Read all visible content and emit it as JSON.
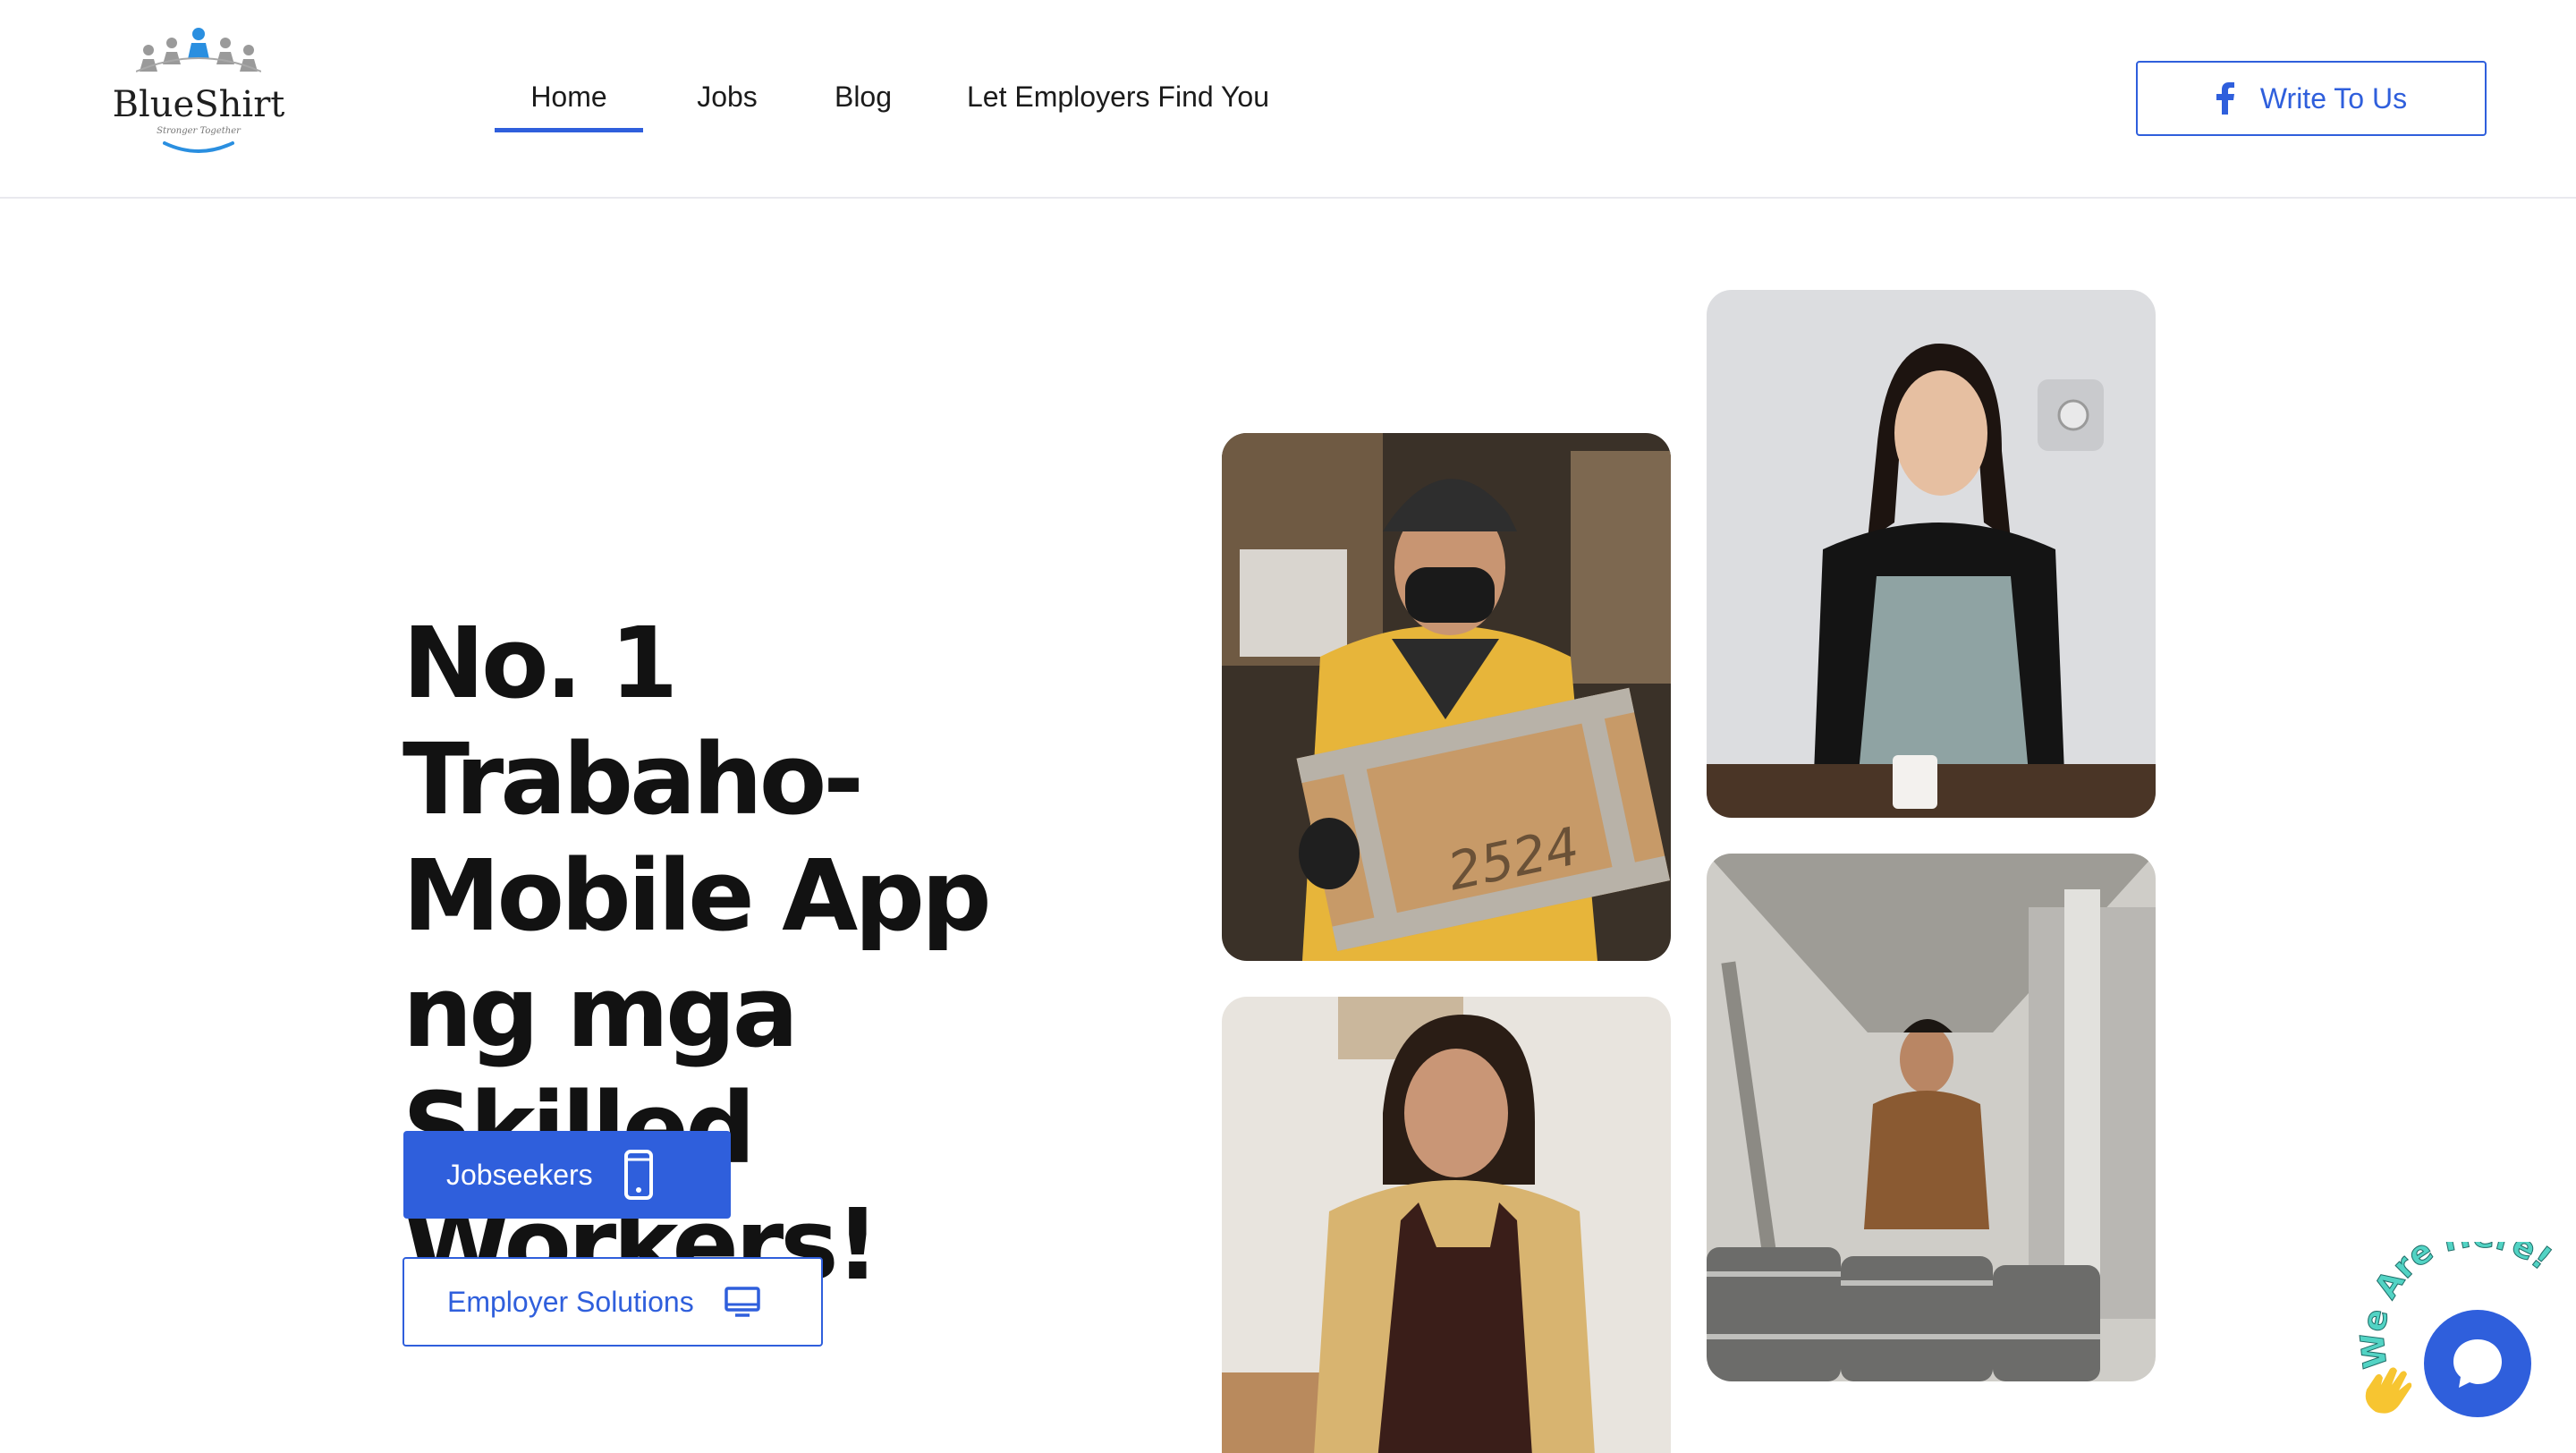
{
  "brand": {
    "name": "BlueShirt",
    "tagline": "Stronger Together",
    "primary_color": "#2f5fdc"
  },
  "nav": {
    "items": [
      {
        "label": "Home",
        "active": true
      },
      {
        "label": "Jobs",
        "active": false
      },
      {
        "label": "Blog",
        "active": false
      },
      {
        "label": "Let Employers Find You",
        "active": false
      }
    ],
    "cta": {
      "label": "Write To Us",
      "icon": "facebook-icon"
    }
  },
  "hero": {
    "title": "No. 1 Trabaho-Mobile App ng mga Skilled Workers!",
    "primary_button": {
      "label": "Jobseekers",
      "icon": "mobile-phone-icon"
    },
    "secondary_button": {
      "label": "Employer Solutions",
      "icon": "desktop-monitor-icon"
    }
  },
  "photos": {
    "items": [
      {
        "subject": "delivery worker holding box",
        "box_label": "2524"
      },
      {
        "subject": "smiling barista in apron"
      },
      {
        "subject": "smiling woman in apron"
      },
      {
        "subject": "brewery worker with pallet jack and kegs"
      }
    ]
  },
  "chat": {
    "label": "We Are Here!",
    "icon": "chat-bubble-icon",
    "wave_icon": "waving-hand-icon"
  }
}
